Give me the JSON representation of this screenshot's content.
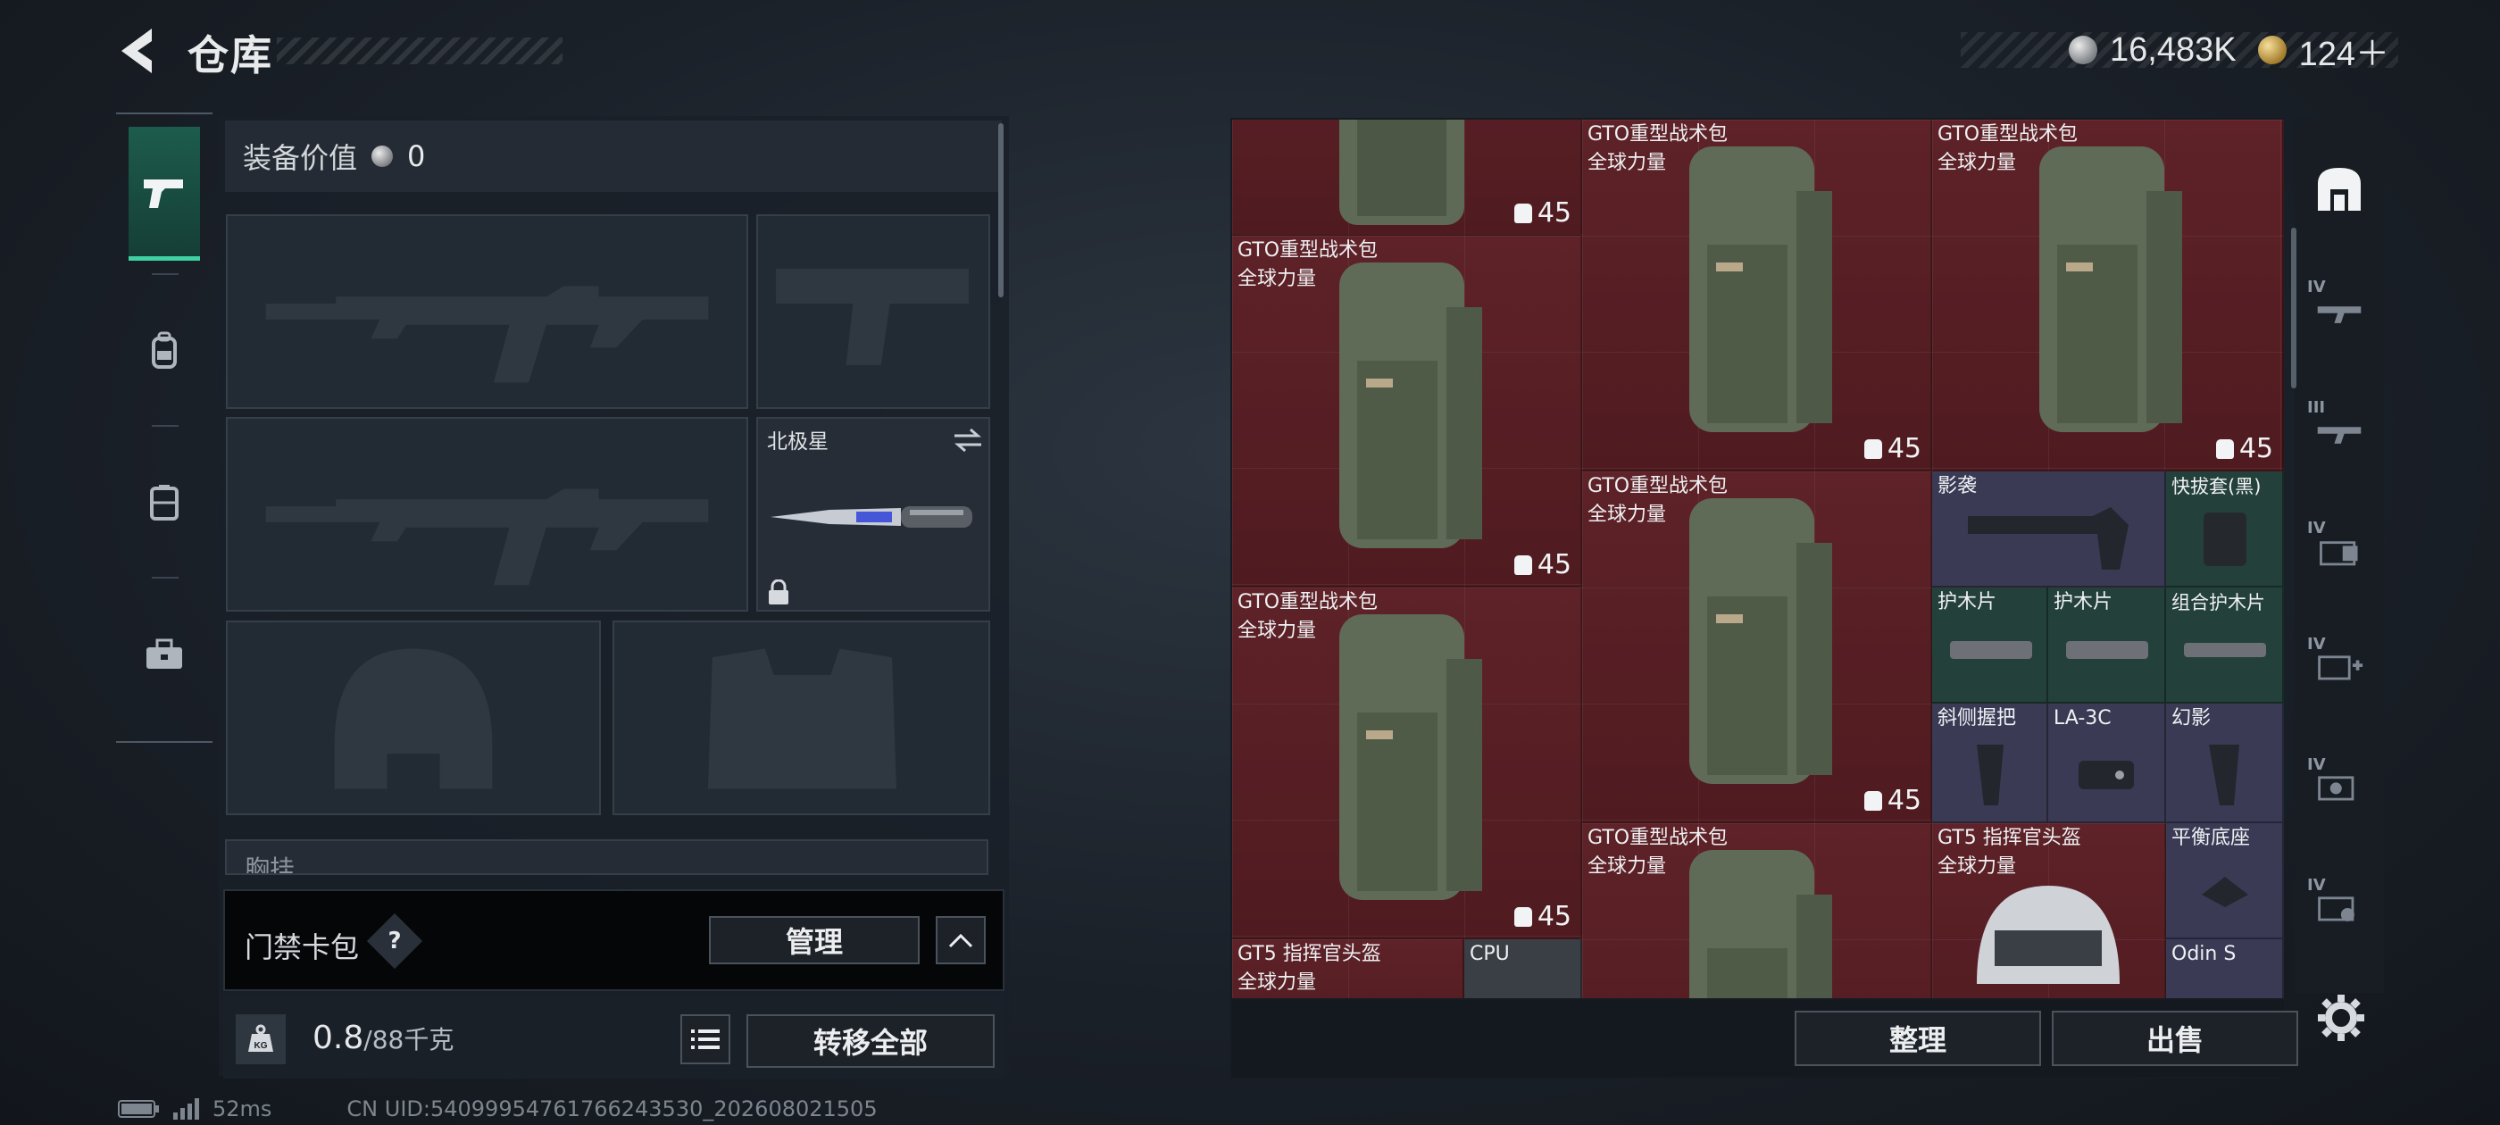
{
  "header": {
    "title": "仓库",
    "currency_silver": "16,483K",
    "currency_gold": "124＋"
  },
  "equipment": {
    "value_label": "装备价值",
    "value_amount": "0",
    "knife_name": "北极星",
    "chest_label": "胸挂",
    "keycard_label": "门禁卡包",
    "help_glyph": "?",
    "manage_label": "管理",
    "weight_value": "0.8",
    "weight_max": "/88千克",
    "transfer_label": "转移全部",
    "kg_label": "KG"
  },
  "status": {
    "ping": "52ms",
    "uid": "CN UID:5409995476176​6243530_202608021505"
  },
  "storage": {
    "items": [
      {
        "name": "",
        "sub": "",
        "count": "45"
      },
      {
        "name": "GTO重型战术包",
        "sub": "全球力量",
        "count": "45"
      },
      {
        "name": "GTO重型战术包",
        "sub": "全球力量",
        "count": "45"
      },
      {
        "name": "GTO重型战术包",
        "sub": "全球力量",
        "count": "45"
      },
      {
        "name": "GTO重型战术包",
        "sub": "全球力量",
        "count": "45"
      },
      {
        "name": "GTO重型战术包",
        "sub": "全球力量",
        "count": "45"
      },
      {
        "name": "GTO重型战术包",
        "sub": "全球力量",
        "count": ""
      },
      {
        "name": "影袭",
        "sub": ""
      },
      {
        "name": "快拔套(黑)",
        "sub": ""
      },
      {
        "name": "护木片",
        "sub": ""
      },
      {
        "name": "护木片",
        "sub": ""
      },
      {
        "name": "组合护木片",
        "sub": ""
      },
      {
        "name": "斜侧握把",
        "sub": ""
      },
      {
        "name": "LA-3C",
        "sub": ""
      },
      {
        "name": "幻影",
        "sub": ""
      },
      {
        "name": "GT5 指挥官头盔",
        "sub": "全球力量"
      },
      {
        "name": "平衡底座",
        "sub": ""
      },
      {
        "name": "GT5 指挥官头盔",
        "sub": "全球力量"
      },
      {
        "name": "CPU",
        "sub": ""
      },
      {
        "name": "Odin S",
        "sub": ""
      }
    ],
    "sort_label": "整理",
    "sell_label": "出售"
  },
  "rail": {
    "tiers": [
      "IV",
      "III",
      "IV",
      "IV",
      "IV",
      "IV"
    ]
  },
  "colors": {
    "active_tab": "#3fd1a2",
    "red_slot": "#5e2228",
    "purple_slot": "#3a3a55",
    "green_slot": "#24403a"
  },
  "icons": [
    "back-arrow-icon",
    "pistol-icon",
    "backpack-icon",
    "vest-icon",
    "toolbox-icon",
    "swap-icon",
    "lock-icon",
    "kg-weight-icon",
    "list-icon",
    "chevron-up-icon",
    "storage-icon",
    "gear-icon"
  ]
}
